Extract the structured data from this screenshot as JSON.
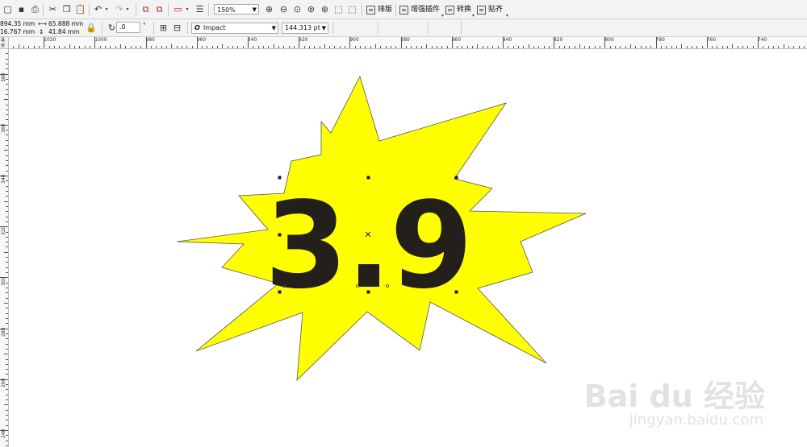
{
  "toolbar": {
    "zoom": "150%",
    "menu_buttons": [
      "排版",
      "增强插件",
      "转换",
      "贴齐"
    ]
  },
  "propbar": {
    "x": "894.35 mm",
    "y": "16.767 mm",
    "width": "65.888 mm",
    "height": "41.84 mm",
    "rotation": ".0",
    "font": "Impact",
    "font_size": "144.313 pt"
  },
  "hruler": {
    "unit": "毫米",
    "labels": [
      "1020",
      "1000",
      "980",
      "960",
      "940",
      "920",
      "900",
      "880",
      "860",
      "840",
      "820",
      "800",
      "780",
      "760",
      "740"
    ]
  },
  "vruler": {
    "labels": [
      "380",
      "360",
      "340",
      "320",
      "300",
      "280",
      "260",
      "240"
    ]
  },
  "canvas": {
    "text_object": "3.9",
    "burst_fill": "#ffff00",
    "text_color": "#231f1b"
  },
  "watermark": {
    "brand": "Bai du 经验",
    "url": "jingyan.baidu.com"
  }
}
